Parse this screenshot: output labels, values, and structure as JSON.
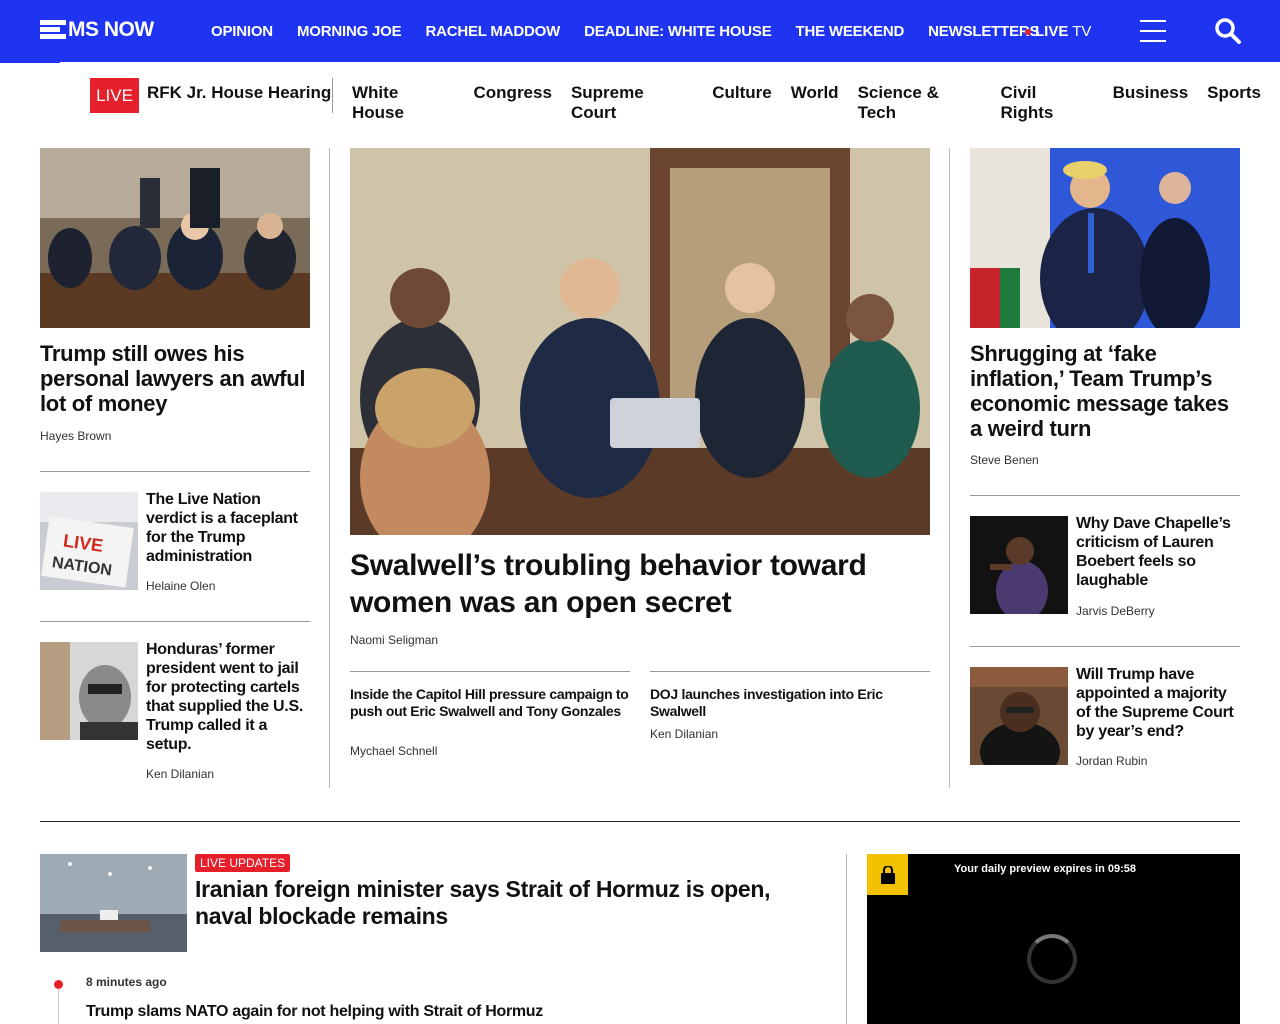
{
  "header": {
    "logo_text": "MS NOW",
    "nav": [
      "OPINION",
      "MORNING JOE",
      "RACHEL MADDOW",
      "DEADLINE: WHITE HOUSE",
      "THE WEEKEND",
      "NEWSLETTERS"
    ],
    "live_tv_label_bold": "LIVE",
    "live_tv_label_rest": " TV",
    "brand_color": "#1f34f0",
    "accent_red": "#e6202a"
  },
  "subnav": {
    "live_badge": "LIVE",
    "live_topic": "RFK Jr. House Hearing",
    "links": [
      "White House",
      "Congress",
      "Supreme Court",
      "Culture",
      "World",
      "Science & Tech",
      "Civil Rights",
      "Business",
      "Sports"
    ]
  },
  "left": {
    "lead": {
      "headline": "Trump still owes his personal lawyers an awful lot of money",
      "byline": "Hayes Brown"
    },
    "items": [
      {
        "headline": "The Live Nation verdict is a faceplant for the Trump administration",
        "byline": "Helaine Olen"
      },
      {
        "headline": "Honduras’ former president went to jail for protecting cartels that supplied the U.S. Trump called it a setup.",
        "byline": "Ken Dilanian"
      }
    ]
  },
  "center": {
    "main": {
      "headline": "Swalwell’s troubling behavior toward women was an open secret",
      "byline": "Naomi Seligman"
    },
    "related": [
      {
        "headline": "Inside the Capitol Hill pressure campaign to push out Eric Swalwell and Tony Gonzales",
        "byline": "Mychael Schnell"
      },
      {
        "headline": "DOJ launches investigation into Eric Swalwell",
        "byline": "Ken Dilanian"
      }
    ]
  },
  "right": {
    "lead": {
      "headline": "Shrugging at ‘fake inflation,’ Team Trump’s economic message takes a weird turn",
      "byline": "Steve Benen"
    },
    "items": [
      {
        "headline": "Why Dave Chapelle’s criticism of Lauren Boebert feels so laughable",
        "byline": "Jarvis DeBerry"
      },
      {
        "headline": "Will Trump have appointed a majority of the Supreme Court by year’s end?",
        "byline": "Jordan Rubin"
      }
    ]
  },
  "live_section": {
    "badge": "LIVE UPDATES",
    "headline": "Iranian foreign minister says Strait of Hormuz is open, naval blockade remains",
    "timeline": [
      {
        "time": "8 minutes ago",
        "headline": "Trump slams NATO again for not helping with Strait of Hormuz"
      }
    ]
  },
  "video": {
    "preview_text": "Your daily preview expires in 09:58"
  }
}
